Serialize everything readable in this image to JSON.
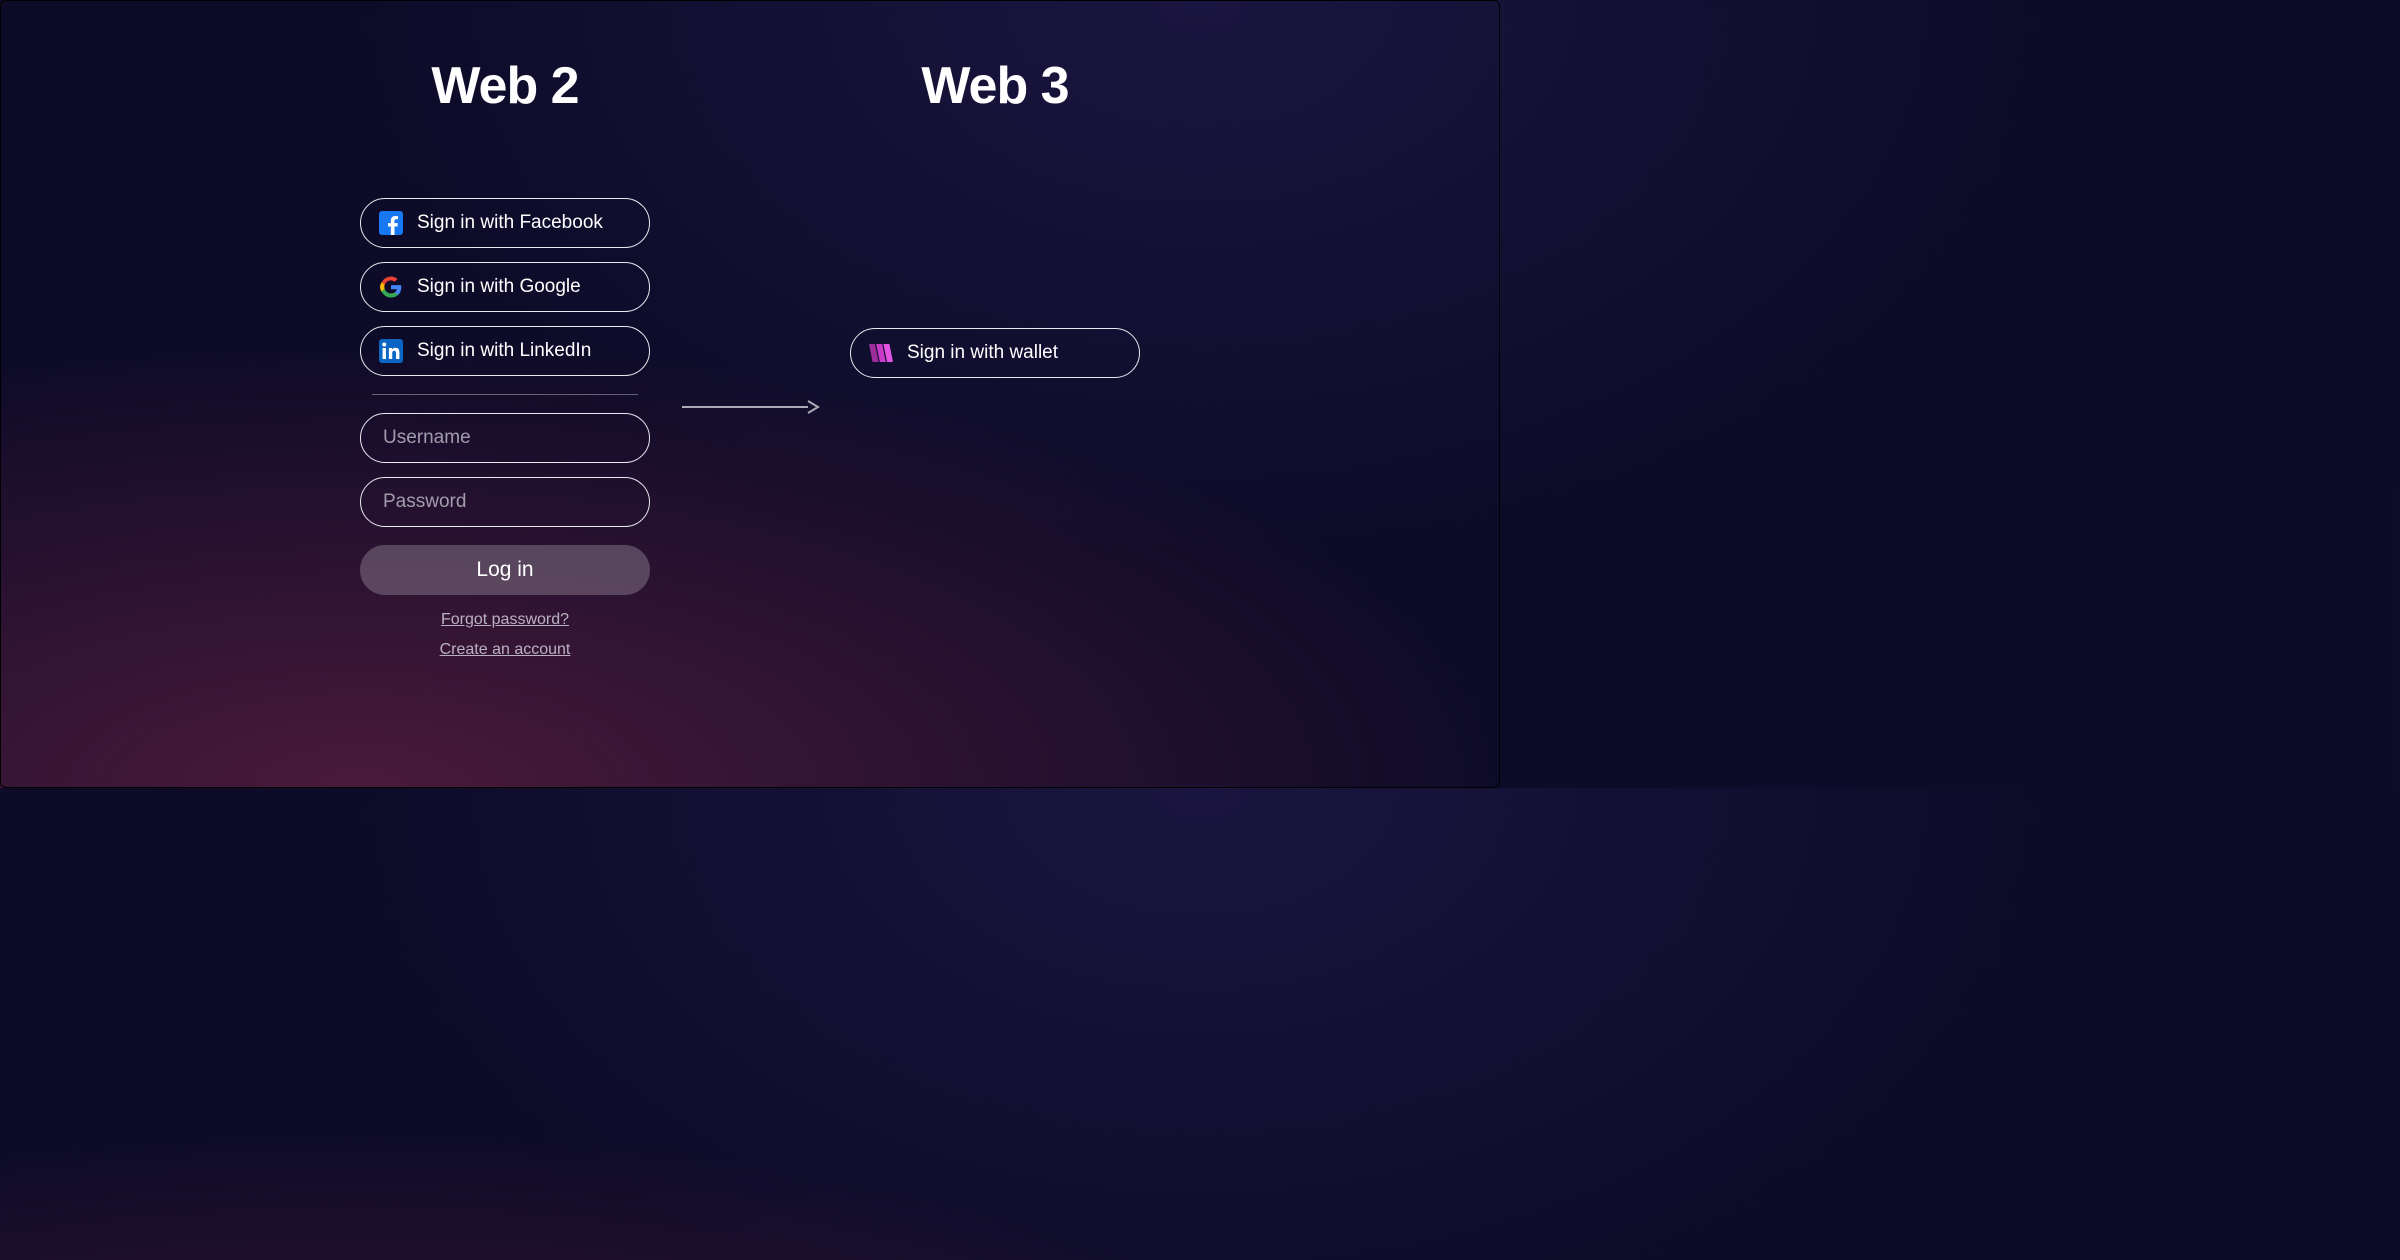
{
  "web2": {
    "heading": "Web 2",
    "facebook_label": "Sign in with Facebook",
    "google_label": "Sign in with Google",
    "linkedin_label": "Sign in with LinkedIn",
    "username_placeholder": "Username",
    "password_placeholder": "Password",
    "login_label": "Log in",
    "forgot_label": "Forgot password?",
    "create_label": "Create an account"
  },
  "web3": {
    "heading": "Web 3",
    "wallet_label": "Sign in with wallet"
  }
}
